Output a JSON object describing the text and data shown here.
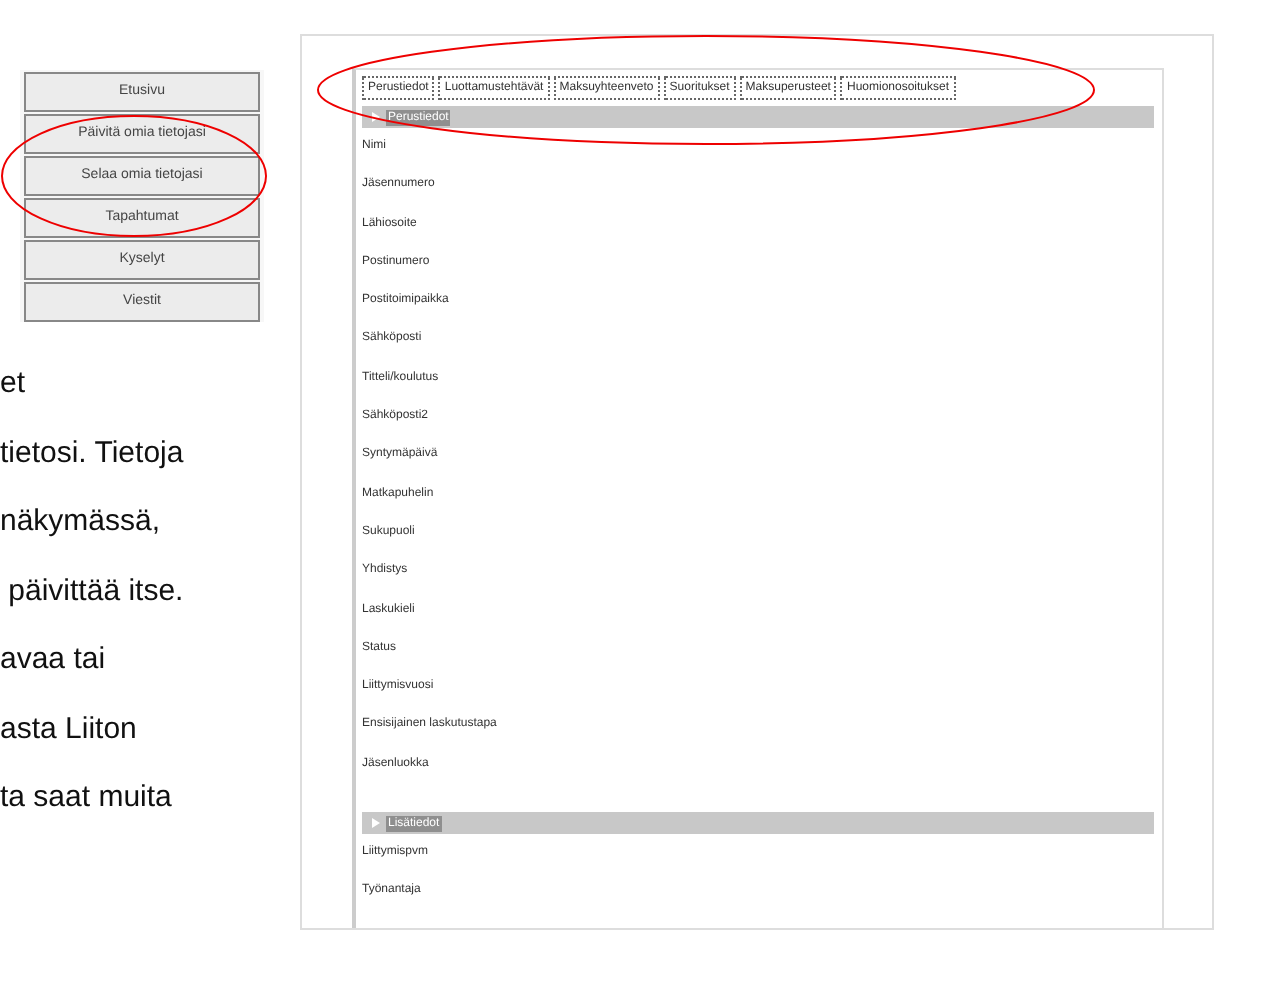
{
  "sidebar": {
    "items": [
      {
        "label": "Etusivu"
      },
      {
        "label": "Päivitä omia tietojasi"
      },
      {
        "label": "Selaa omia tietojasi"
      },
      {
        "label": "Tapahtumat"
      },
      {
        "label": "Kyselyt"
      },
      {
        "label": "Viestit"
      }
    ]
  },
  "text_lines": [
    "et",
    "tietosi. Tietoja",
    "näkymässä,",
    " päivittää itse.",
    "avaa tai",
    "asta Liiton",
    "ta saat muita"
  ],
  "tabs": [
    {
      "label": "Perustiedot"
    },
    {
      "label": "Luottamustehtävät"
    },
    {
      "label": "Maksuyhteenveto"
    },
    {
      "label": "Suoritukset"
    },
    {
      "label": "Maksuperusteet"
    },
    {
      "label": "Huomionosoitukset"
    }
  ],
  "sections": [
    {
      "title": "Perustiedot",
      "fields": [
        "Nimi",
        "Jäsennumero",
        "Lähiosoite",
        "Postinumero",
        "Postitoimipaikka",
        "Sähköposti",
        "Titteli/koulutus",
        "Sähköposti2",
        "Syntymäpäivä",
        "Matkapuhelin",
        "Sukupuoli",
        "Yhdistys",
        "Laskukieli",
        "Status",
        "Liittymisvuosi",
        "Ensisijainen laskutustapa",
        "Jäsenluokka"
      ]
    },
    {
      "title": "Lisätiedot",
      "fields": [
        "Liittymispvm",
        "Työnantaja"
      ]
    }
  ]
}
